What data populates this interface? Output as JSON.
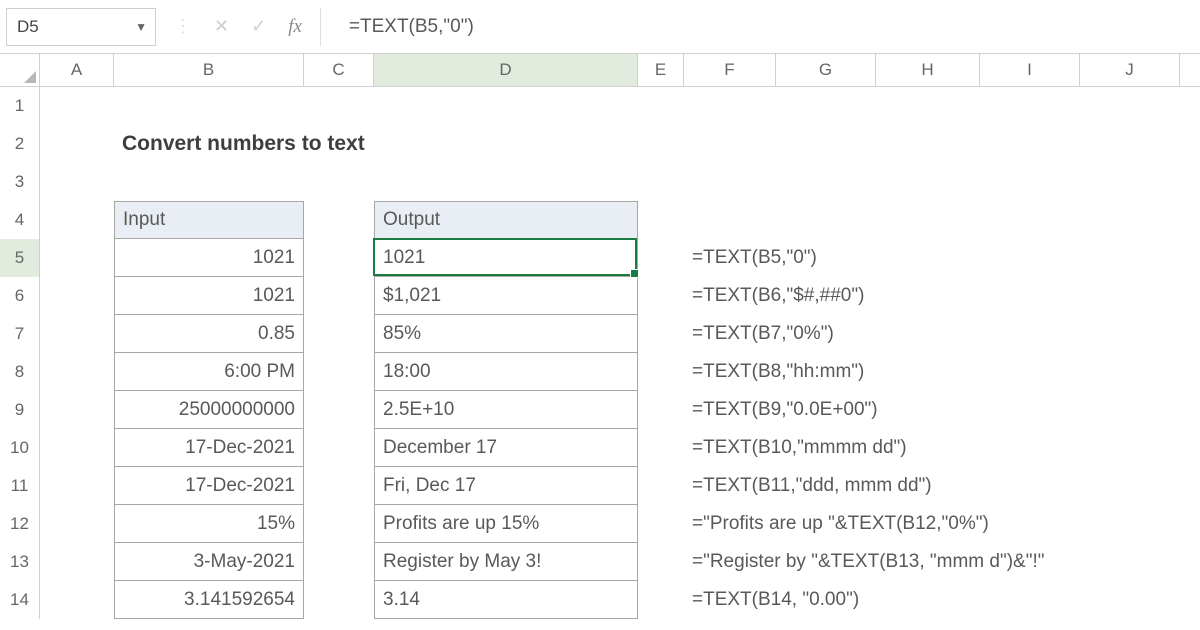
{
  "namebox": {
    "value": "D5"
  },
  "formula_bar": {
    "value": "=TEXT(B5,\"0\")"
  },
  "columns": [
    "A",
    "B",
    "C",
    "D",
    "E",
    "F",
    "G",
    "H",
    "I",
    "J"
  ],
  "row_numbers": [
    "1",
    "2",
    "3",
    "4",
    "5",
    "6",
    "7",
    "8",
    "9",
    "10",
    "11",
    "12",
    "13",
    "14"
  ],
  "title": "Convert numbers to text",
  "headers": {
    "input": "Input",
    "output": "Output"
  },
  "rows": [
    {
      "input": "1021",
      "output": "1021",
      "formula": "=TEXT(B5,\"0\")"
    },
    {
      "input": "1021",
      "output": "$1,021",
      "formula": "=TEXT(B6,\"$#,##0\")"
    },
    {
      "input": "0.85",
      "output": "85%",
      "formula": "=TEXT(B7,\"0%\")"
    },
    {
      "input": "6:00 PM",
      "output": "18:00",
      "formula": "=TEXT(B8,\"hh:mm\")"
    },
    {
      "input": "25000000000",
      "output": "2.5E+10",
      "formula": "=TEXT(B9,\"0.0E+00\")"
    },
    {
      "input": "17-Dec-2021",
      "output": "December 17",
      "formula": "=TEXT(B10,\"mmmm dd\")"
    },
    {
      "input": "17-Dec-2021",
      "output": "Fri, Dec 17",
      "formula": "=TEXT(B11,\"ddd, mmm dd\")"
    },
    {
      "input": "15%",
      "output": "Profits are up 15%",
      "formula": "=\"Profits are up \"&TEXT(B12,\"0%\")"
    },
    {
      "input": "3-May-2021",
      "output": "Register by May 3!",
      "formula": "=\"Register by \"&TEXT(B13, \"mmm d\")&\"!\""
    },
    {
      "input": "3.141592654",
      "output": "3.14",
      "formula": "=TEXT(B14, \"0.00\")"
    }
  ],
  "highlight": {
    "column": "D",
    "row": "5"
  },
  "col_widths": {
    "A": 74,
    "B": 190,
    "C": 70,
    "D": 264,
    "E": 46,
    "F": 92,
    "G": 100,
    "H": 104,
    "I": 100,
    "J": 100
  }
}
